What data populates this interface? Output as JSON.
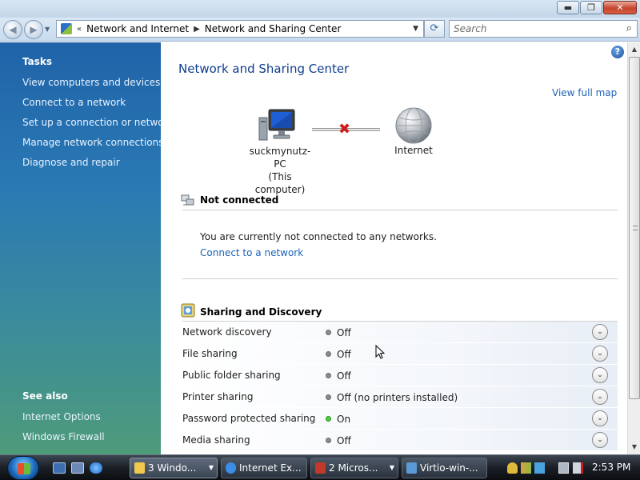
{
  "window": {
    "minimize": "▬",
    "maximize": "❐",
    "close": "✕"
  },
  "nav": {
    "back": "◀",
    "forward": "▶",
    "history_dropdown": "▼",
    "breadcrumb_overflow": "«",
    "breadcrumb": [
      "Network and Internet",
      "Network and Sharing Center"
    ],
    "breadcrumb_sep": "▶",
    "address_dropdown": "▼",
    "refresh": "⟳",
    "search_placeholder": "Search",
    "search_icon": "⌕"
  },
  "sidebar": {
    "tasks_heading": "Tasks",
    "tasks": [
      "View computers and devices",
      "Connect to a network",
      "Set up a connection or network",
      "Manage network connections",
      "Diagnose and repair"
    ],
    "see_also_heading": "See also",
    "see_also": [
      "Internet Options",
      "Windows Firewall"
    ]
  },
  "main": {
    "help": "?",
    "title": "Network and Sharing Center",
    "view_full_map": "View full map",
    "computer_name": "suckmynutz-PC",
    "computer_sub": "(This computer)",
    "disconnected_mark": "✖",
    "internet_label": "Internet",
    "not_connected_title": "Not connected",
    "not_connected_message": "You are currently not connected to any networks.",
    "connect_link": "Connect to a network",
    "sharing_title": "Sharing and Discovery",
    "expand_glyph": "⌄",
    "sharing_rows": [
      {
        "name": "Network discovery",
        "status": "Off",
        "on": false
      },
      {
        "name": "File sharing",
        "status": "Off",
        "on": false
      },
      {
        "name": "Public folder sharing",
        "status": "Off",
        "on": false
      },
      {
        "name": "Printer sharing",
        "status": "Off (no printers installed)",
        "on": false
      },
      {
        "name": "Password protected sharing",
        "status": "On",
        "on": true
      },
      {
        "name": "Media sharing",
        "status": "Off",
        "on": false
      }
    ]
  },
  "scrollbar": {
    "up": "▲",
    "down": "▼"
  },
  "taskbar": {
    "tasks": [
      {
        "label": "3 Windo...",
        "icon_color": "#f2c94c",
        "dropdown": "▼"
      },
      {
        "label": "Internet Ex...",
        "icon_color": "#3a8ee6",
        "dropdown": ""
      },
      {
        "label": "2 Micros...",
        "icon_color": "#c0392b",
        "dropdown": "▼"
      },
      {
        "label": "Virtio-win-...",
        "icon_color": "#5b9bd5",
        "dropdown": ""
      }
    ],
    "clock": "2:53 PM"
  }
}
